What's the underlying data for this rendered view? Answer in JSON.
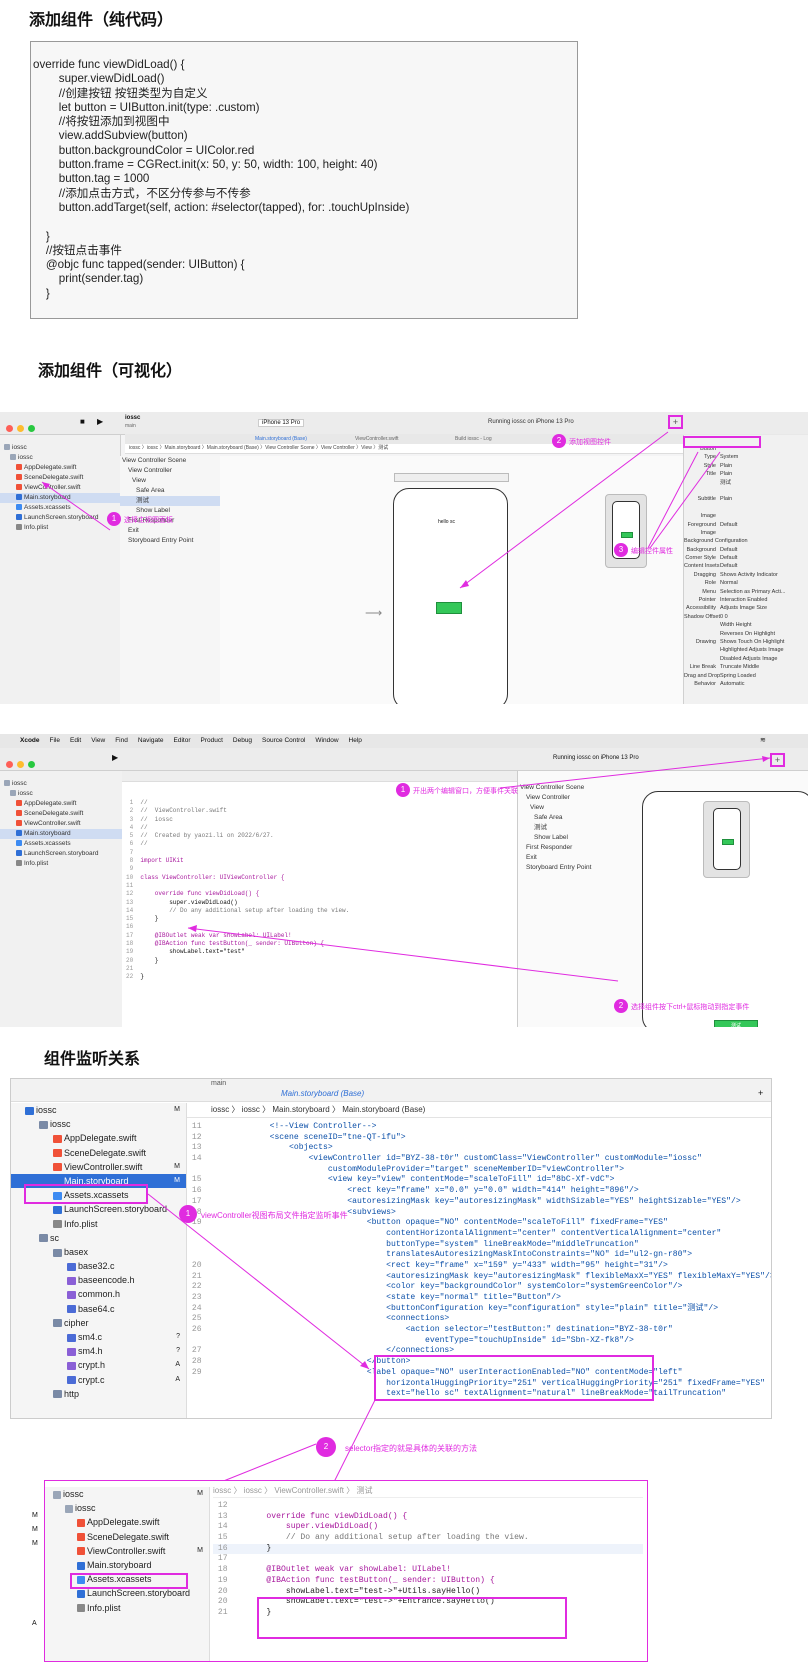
{
  "section1": {
    "title": "添加组件（纯代码）",
    "code": [
      "override func viewDidLoad() {",
      "        super.viewDidLoad()",
      "        //创建按钮 按钮类型为自定义",
      "        let button = UIButton.init(type: .custom)",
      "        //将按钮添加到视图中",
      "        view.addSubview(button)",
      "        button.backgroundColor = UIColor.red",
      "        button.frame = CGRect.init(x: 50, y: 50, width: 100, height: 40)",
      "        button.tag = 1000",
      "        //添加点击方式，不区分传参与不传参",
      "        button.addTarget(self, action: #selector(tapped), for: .touchUpInside)",
      "",
      "    }",
      "    //按钮点击事件",
      "    @objc func tapped(sender: UIButton) {",
      "        print(sender.tag)",
      "    }"
    ]
  },
  "section2": {
    "title": "添加组件（可视化）",
    "scheme": "iossc",
    "branch": "main",
    "device": "iPhone 13 Pro",
    "status": "Running iossc on iPhone 13 Pro",
    "tabs": [
      "Main.storyboard (Base)",
      "ViewController.swift",
      "Build iossc - Log"
    ],
    "files": [
      "iossc",
      "iossc",
      "AppDelegate.swift",
      "SceneDelegate.swift",
      "ViewController.swift",
      "Main.storyboard",
      "Assets.xcassets",
      "LaunchScreen.storyboard",
      "Info.plist"
    ],
    "scene": [
      "View Controller Scene",
      "View Controller",
      "View",
      "Safe Area",
      "测试",
      "Show Label",
      "First Responder",
      "Exit",
      "Storyboard Entry Point"
    ],
    "breadcrumb": "iossc 〉iossc 〉Main.storyboard 〉Main.storyboard (Base) 〉View Controller Scene 〉View Controller 〉View 〉测试",
    "phone_label": "hello sc",
    "annotations": [
      {
        "n": "1",
        "text": "选择主视图面板"
      },
      {
        "n": "2",
        "text": "添加视图控件"
      },
      {
        "n": "3",
        "text": "编辑控件属性"
      }
    ],
    "inspector": [
      [
        "Button",
        ""
      ],
      [
        "Type",
        "System"
      ],
      [
        "Style",
        "Plain"
      ],
      [
        "Title",
        "Plain"
      ],
      [
        "",
        "测试"
      ],
      [
        "",
        ""
      ],
      [
        "Subtitle",
        "Plain"
      ],
      [
        "",
        ""
      ],
      [
        "Image",
        ""
      ],
      [
        "Foreground",
        "Default"
      ],
      [
        "Image",
        ""
      ],
      [
        "Background Configuration",
        ""
      ],
      [
        "Background",
        "Default"
      ],
      [
        "Corner Style",
        "Default"
      ],
      [
        "Content Insets",
        "Default"
      ],
      [
        "Dragging",
        "Shows Activity Indicator"
      ],
      [
        "Role",
        "Normal"
      ],
      [
        "Menu",
        "Selection as Primary Acti..."
      ],
      [
        "Pointer",
        "Interaction Enabled"
      ],
      [
        "Accessibility",
        "Adjusts Image Size"
      ],
      [
        "Shadow Offset",
        "0   0"
      ],
      [
        "",
        "Width   Height"
      ],
      [
        "",
        "Reverses On Highlight"
      ],
      [
        "Drawing",
        "Shows Touch On Highlight"
      ],
      [
        "",
        "Highlighted Adjusts Image"
      ],
      [
        "",
        "Disabled Adjusts Image"
      ],
      [
        "Line Break",
        "Truncate Middle"
      ],
      [
        "Drag and Drop",
        "Spring Loaded"
      ],
      [
        "Behavior",
        "Automatic"
      ]
    ]
  },
  "section3": {
    "menubar": [
      "Xcode",
      "File",
      "Edit",
      "View",
      "Find",
      "Navigate",
      "Editor",
      "Product",
      "Debug",
      "Source Control",
      "Window",
      "Help"
    ],
    "status": "Running iossc on iPhone 13 Pro",
    "code": [
      "//",
      "//  ViewController.swift",
      "//  iossc",
      "//",
      "//  Created by yaozi.li on 2022/6/27.",
      "//",
      "",
      "import UIKit",
      "",
      "class ViewController: UIViewController {",
      "",
      "    override func viewDidLoad() {",
      "        super.viewDidLoad()",
      "        // Do any additional setup after loading the view.",
      "    }",
      "",
      "    @IBOutlet weak var showLabel: UILabel!",
      "    @IBAction func testButton(_ sender: UIButton) {",
      "        showLabel.text=\"test\"",
      "    }",
      "",
      "}"
    ],
    "annotations": [
      {
        "n": "1",
        "text": "开出两个编辑窗口，方便事件关联"
      },
      {
        "n": "2",
        "text": "选择组件按下ctrl+鼠标拖动到指定事件"
      }
    ],
    "button_label": "测试"
  },
  "section4": {
    "title": "组件监听关系",
    "breadcrumb": [
      "iossc",
      "iossc",
      "Main.storyboard",
      "Main.storyboard (Base)"
    ],
    "tab": "Main.storyboard (Base)",
    "branch": "main",
    "tree": [
      {
        "name": "iossc",
        "badge": "M",
        "level": 0,
        "kind": "proj"
      },
      {
        "name": "iossc",
        "badge": "",
        "level": 1,
        "kind": "folder"
      },
      {
        "name": "AppDelegate.swift",
        "badge": "",
        "level": 2,
        "kind": "swift"
      },
      {
        "name": "SceneDelegate.swift",
        "badge": "",
        "level": 2,
        "kind": "swift"
      },
      {
        "name": "ViewController.swift",
        "badge": "M",
        "level": 2,
        "kind": "swift"
      },
      {
        "name": "Main.storyboard",
        "badge": "M",
        "level": 2,
        "kind": "sb",
        "selected": true
      },
      {
        "name": "Assets.xcassets",
        "badge": "",
        "level": 2,
        "kind": "assets"
      },
      {
        "name": "LaunchScreen.storyboard",
        "badge": "",
        "level": 2,
        "kind": "sb"
      },
      {
        "name": "Info.plist",
        "badge": "",
        "level": 2,
        "kind": "plist"
      },
      {
        "name": "sc",
        "badge": "",
        "level": 1,
        "kind": "folder"
      },
      {
        "name": "basex",
        "badge": "",
        "level": 2,
        "kind": "folder"
      },
      {
        "name": "base32.c",
        "badge": "",
        "level": 3,
        "kind": "c"
      },
      {
        "name": "baseencode.h",
        "badge": "",
        "level": 3,
        "kind": "h"
      },
      {
        "name": "common.h",
        "badge": "",
        "level": 3,
        "kind": "h"
      },
      {
        "name": "base64.c",
        "badge": "",
        "level": 3,
        "kind": "c"
      },
      {
        "name": "cipher",
        "badge": "",
        "level": 2,
        "kind": "folder"
      },
      {
        "name": "sm4.c",
        "badge": "?",
        "level": 3,
        "kind": "c"
      },
      {
        "name": "sm4.h",
        "badge": "?",
        "level": 3,
        "kind": "h"
      },
      {
        "name": "crypt.h",
        "badge": "A",
        "level": 3,
        "kind": "h"
      },
      {
        "name": "crypt.c",
        "badge": "A",
        "level": 3,
        "kind": "c"
      },
      {
        "name": "http",
        "badge": "",
        "level": 2,
        "kind": "folder"
      }
    ],
    "xml_lines": [
      {
        "n": "11",
        "t": "            <!--View Controller-->"
      },
      {
        "n": "12",
        "t": "            <scene sceneID=\"tne-QT-ifu\">"
      },
      {
        "n": "13",
        "t": "                <objects>"
      },
      {
        "n": "14",
        "t": "                    <viewController id=\"BYZ-38-t0r\" customClass=\"ViewController\" customModule=\"iossc\""
      },
      {
        "n": "",
        "t": "                        customModuleProvider=\"target\" sceneMemberID=\"viewController\">"
      },
      {
        "n": "15",
        "t": "                        <view key=\"view\" contentMode=\"scaleToFill\" id=\"8bC-Xf-vdC\">"
      },
      {
        "n": "16",
        "t": "                            <rect key=\"frame\" x=\"0.0\" y=\"0.0\" width=\"414\" height=\"896\"/>"
      },
      {
        "n": "17",
        "t": "                            <autoresizingMask key=\"autoresizingMask\" widthSizable=\"YES\" heightSizable=\"YES\"/>"
      },
      {
        "n": "18",
        "t": "                            <subviews>"
      },
      {
        "n": "19",
        "t": "                                <button opaque=\"NO\" contentMode=\"scaleToFill\" fixedFrame=\"YES\""
      },
      {
        "n": "",
        "t": "                                    contentHorizontalAlignment=\"center\" contentVerticalAlignment=\"center\""
      },
      {
        "n": "",
        "t": "                                    buttonType=\"system\" lineBreakMode=\"middleTruncation\""
      },
      {
        "n": "",
        "t": "                                    translatesAutoresizingMaskIntoConstraints=\"NO\" id=\"ul2-gn-r80\">"
      },
      {
        "n": "20",
        "t": "                                    <rect key=\"frame\" x=\"159\" y=\"433\" width=\"95\" height=\"31\"/>"
      },
      {
        "n": "21",
        "t": "                                    <autoresizingMask key=\"autoresizingMask\" flexibleMaxX=\"YES\" flexibleMaxY=\"YES\"/>"
      },
      {
        "n": "22",
        "t": "                                    <color key=\"backgroundColor\" systemColor=\"systemGreenColor\"/>"
      },
      {
        "n": "23",
        "t": "                                    <state key=\"normal\" title=\"Button\"/>"
      },
      {
        "n": "24",
        "t": "                                    <buttonConfiguration key=\"configuration\" style=\"plain\" title=\"测试\"/>"
      },
      {
        "n": "25",
        "t": "                                    <connections>"
      },
      {
        "n": "26",
        "t": "                                        <action selector=\"testButton:\" destination=\"BYZ-38-t0r\""
      },
      {
        "n": "",
        "t": "                                            eventType=\"touchUpInside\" id=\"Sbn-XZ-fk8\"/>"
      },
      {
        "n": "27",
        "t": "                                    </connections>"
      },
      {
        "n": "28",
        "t": "                                </button>"
      },
      {
        "n": "29",
        "t": "                                <label opaque=\"NO\" userInteractionEnabled=\"NO\" contentMode=\"left\""
      },
      {
        "n": "",
        "t": "                                    horizontalHuggingPriority=\"251\" verticalHuggingPriority=\"251\" fixedFrame=\"YES\""
      },
      {
        "n": "",
        "t": "                                    text=\"hello sc\" textAlignment=\"natural\" lineBreakMode=\"tailTruncation\""
      }
    ],
    "annotations": [
      {
        "n": "1",
        "text": "viewController视图布局文件指定监听事件"
      },
      {
        "n": "2",
        "text": "selector指定的就是具体的关联的方法"
      }
    ],
    "bottom_breadcrumb": [
      "iossc",
      "iossc",
      "ViewController.swift",
      "测试"
    ],
    "bottom_tree": [
      {
        "name": "iossc",
        "badge": "M",
        "level": 0
      },
      {
        "name": "iossc",
        "badge": "",
        "level": 1
      },
      {
        "name": "AppDelegate.swift",
        "badge": "",
        "level": 2
      },
      {
        "name": "SceneDelegate.swift",
        "badge": "",
        "level": 2
      },
      {
        "name": "ViewController.swift",
        "badge": "M",
        "level": 2,
        "boxed": true
      },
      {
        "name": "Main.storyboard",
        "badge": "",
        "level": 2
      },
      {
        "name": "Assets.xcassets",
        "badge": "",
        "level": 2
      },
      {
        "name": "LaunchScreen.storyboard",
        "badge": "",
        "level": 2
      },
      {
        "name": "Info.plist",
        "badge": "",
        "level": 2
      }
    ],
    "left_margin_badges": [
      "M",
      "M",
      "M",
      "A"
    ],
    "swift_lines": [
      {
        "n": "12",
        "t": ""
      },
      {
        "n": "13",
        "t": "    override func viewDidLoad() {"
      },
      {
        "n": "14",
        "t": "        super.viewDidLoad()"
      },
      {
        "n": "15",
        "t": "        // Do any additional setup after loading the view."
      },
      {
        "n": "16",
        "t": "    }"
      },
      {
        "n": "17",
        "t": ""
      },
      {
        "n": "18",
        "t": "    @IBOutlet weak var showLabel: UILabel!"
      },
      {
        "n": "19",
        "t": "    @IBAction func testButton(_ sender: UIButton) {"
      },
      {
        "n": "20",
        "t": "        showLabel.text=\"test->\"+Utils.sayHello()"
      },
      {
        "n": "20",
        "t": "        showLabel.text=\"test->\"+Entrance.sayHello()"
      },
      {
        "n": "21",
        "t": "    }"
      }
    ]
  },
  "colors": {
    "magenta": "#e02be0",
    "green": "#34c759",
    "selection": "#2f6fd6"
  }
}
